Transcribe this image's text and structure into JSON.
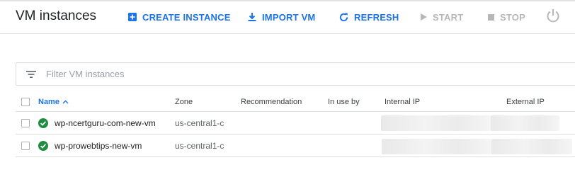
{
  "header": {
    "title": "VM instances"
  },
  "toolbar": {
    "create_label": "CREATE INSTANCE",
    "import_label": "IMPORT VM",
    "refresh_label": "REFRESH",
    "start_label": "START",
    "stop_label": "STOP"
  },
  "filter": {
    "placeholder": "Filter VM instances"
  },
  "table": {
    "columns": {
      "name": "Name",
      "zone": "Zone",
      "recommendation": "Recommendation",
      "in_use_by": "In use by",
      "internal_ip": "Internal IP",
      "external_ip": "External IP"
    },
    "rows": [
      {
        "name": "wp-ncertguru-com-new-vm",
        "zone": "us-central1-c",
        "status": "running"
      },
      {
        "name": "wp-prowebtips-new-vm",
        "zone": "us-central1-c",
        "status": "running"
      }
    ]
  },
  "colors": {
    "accent": "#1a73e8",
    "disabled": "#b7b7b7",
    "status_ok": "#1e8e3e"
  },
  "icons": {
    "create": "add-box-icon",
    "import": "download-icon",
    "refresh": "refresh-icon",
    "start": "play-icon",
    "stop": "stop-icon",
    "power": "power-icon",
    "filter": "filter-icon",
    "status": "check-circle-icon"
  }
}
